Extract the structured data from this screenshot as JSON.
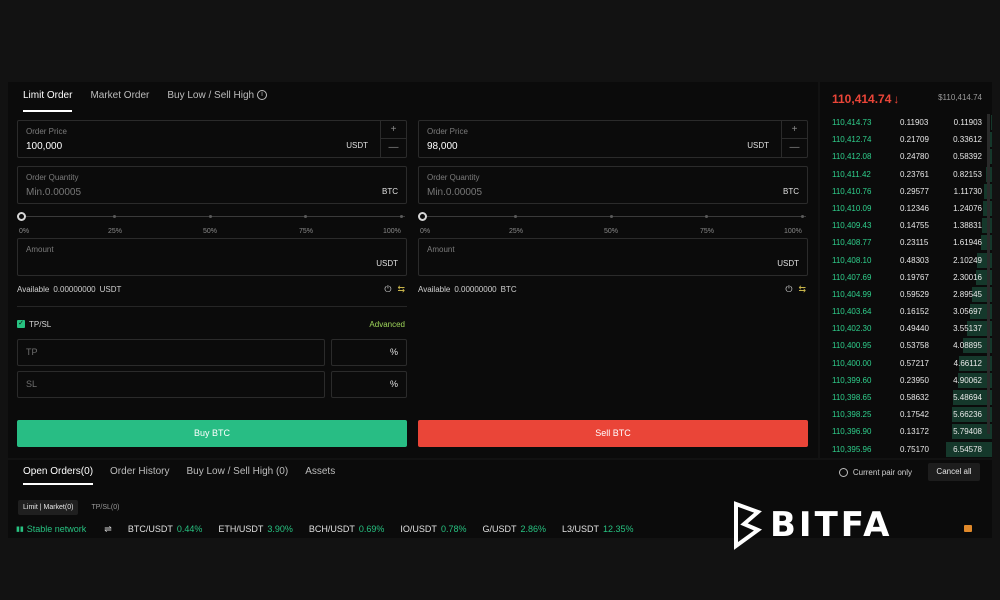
{
  "order_tabs": [
    "Limit Order",
    "Market Order",
    "Buy Low / Sell High"
  ],
  "buy": {
    "price_label": "Order Price",
    "price_value": "100,000",
    "price_unit": "USDT",
    "qty_label": "Order Quantity",
    "qty_placeholder": "Min.0.00005",
    "qty_unit": "BTC",
    "amount_label": "Amount",
    "amount_unit": "USDT",
    "available_label": "Available",
    "available_value": "0.00000000",
    "available_unit": "USDT",
    "button": "Buy BTC"
  },
  "sell": {
    "price_label": "Order Price",
    "price_value": "98,000",
    "price_unit": "USDT",
    "qty_label": "Order Quantity",
    "qty_placeholder": "Min.0.00005",
    "qty_unit": "BTC",
    "amount_label": "Amount",
    "amount_unit": "USDT",
    "available_label": "Available",
    "available_value": "0.00000000",
    "available_unit": "BTC",
    "button": "Sell BTC"
  },
  "slider": {
    "marks": [
      "0%",
      "25%",
      "50%",
      "75%",
      "100%"
    ],
    "buy_level": 0,
    "sell_level": 0
  },
  "stepper": {
    "plus": "+",
    "minus": "—"
  },
  "tpsl": {
    "label": "TP/SL",
    "checked": true,
    "advanced": "Advanced",
    "tp_placeholder": "TP",
    "sl_placeholder": "SL",
    "percent": "%"
  },
  "orderbook": {
    "last_price": "110,414.74",
    "index_price": "$110,414.74",
    "rows": [
      {
        "price": "110,414.73",
        "amount": "0.11903",
        "total": "0.11903",
        "depth": 0.018
      },
      {
        "price": "110,412.74",
        "amount": "0.21709",
        "total": "0.33612",
        "depth": 0.05
      },
      {
        "price": "110,412.08",
        "amount": "0.24780",
        "total": "0.58392",
        "depth": 0.09
      },
      {
        "price": "110,411.42",
        "amount": "0.23761",
        "total": "0.82153",
        "depth": 0.125
      },
      {
        "price": "110,410.76",
        "amount": "0.29577",
        "total": "1.11730",
        "depth": 0.17
      },
      {
        "price": "110,410.09",
        "amount": "0.12346",
        "total": "1.24076",
        "depth": 0.19
      },
      {
        "price": "110,409.43",
        "amount": "0.14755",
        "total": "1.38831",
        "depth": 0.21
      },
      {
        "price": "110,408.77",
        "amount": "0.23115",
        "total": "1.61946",
        "depth": 0.25
      },
      {
        "price": "110,408.10",
        "amount": "0.48303",
        "total": "2.10249",
        "depth": 0.32
      },
      {
        "price": "110,407.69",
        "amount": "0.19767",
        "total": "2.30016",
        "depth": 0.35
      },
      {
        "price": "110,404.99",
        "amount": "0.59529",
        "total": "2.89545",
        "depth": 0.44
      },
      {
        "price": "110,403.64",
        "amount": "0.16152",
        "total": "3.05697",
        "depth": 0.47
      },
      {
        "price": "110,402.30",
        "amount": "0.49440",
        "total": "3.55137",
        "depth": 0.54
      },
      {
        "price": "110,400.95",
        "amount": "0.53758",
        "total": "4.08895",
        "depth": 0.62
      },
      {
        "price": "110,400.00",
        "amount": "0.57217",
        "total": "4.66112",
        "depth": 0.71
      },
      {
        "price": "110,399.60",
        "amount": "0.23950",
        "total": "4.90062",
        "depth": 0.75
      },
      {
        "price": "110,398.65",
        "amount": "0.58632",
        "total": "5.48694",
        "depth": 0.84
      },
      {
        "price": "110,398.25",
        "amount": "0.17542",
        "total": "5.66236",
        "depth": 0.86
      },
      {
        "price": "110,396.90",
        "amount": "0.13172",
        "total": "5.79408",
        "depth": 0.88
      },
      {
        "price": "110,395.96",
        "amount": "0.75170",
        "total": "6.54578",
        "depth": 1.0
      }
    ]
  },
  "bottom_tabs": [
    "Open Orders(0)",
    "Order History",
    "Buy Low / Sell High (0)",
    "Assets"
  ],
  "current_pair_label": "Current pair only",
  "cancel_all": "Cancel all",
  "sub_tabs": [
    "Limit | Market(0)",
    "TP/SL(0)"
  ],
  "ticker": {
    "network": "Stable network",
    "items": [
      {
        "pair": "BTC/USDT",
        "change": "0.44%"
      },
      {
        "pair": "ETH/USDT",
        "change": "3.90%"
      },
      {
        "pair": "BCH/USDT",
        "change": "0.69%"
      },
      {
        "pair": "IO/USDT",
        "change": "0.78%"
      },
      {
        "pair": "G/USDT",
        "change": "2.86%"
      },
      {
        "pair": "L3/USDT",
        "change": "12.35%"
      }
    ]
  },
  "colors": {
    "buy": "#28bd84",
    "sell": "#ea4538",
    "background": "#121212",
    "panel": "#0b0b0b",
    "depth_bar": "#15382b"
  },
  "logo": "BITFA"
}
